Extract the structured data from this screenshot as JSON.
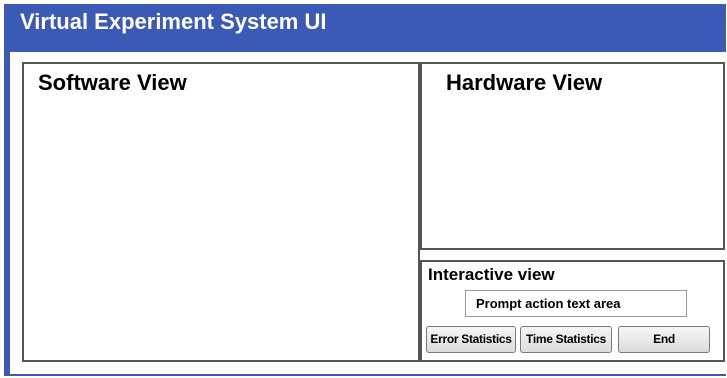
{
  "window": {
    "title": "Virtual Experiment System UI",
    "accent_color": "#3a5ab5"
  },
  "software_view": {
    "title": "Software View"
  },
  "hardware_view": {
    "title": "Hardware View"
  },
  "interactive_view": {
    "title": "Interactive view",
    "prompt_text": "Prompt action text area",
    "buttons": {
      "error_statistics": "Error Statistics",
      "time_statistics": "Time Statistics",
      "end": "End"
    }
  }
}
